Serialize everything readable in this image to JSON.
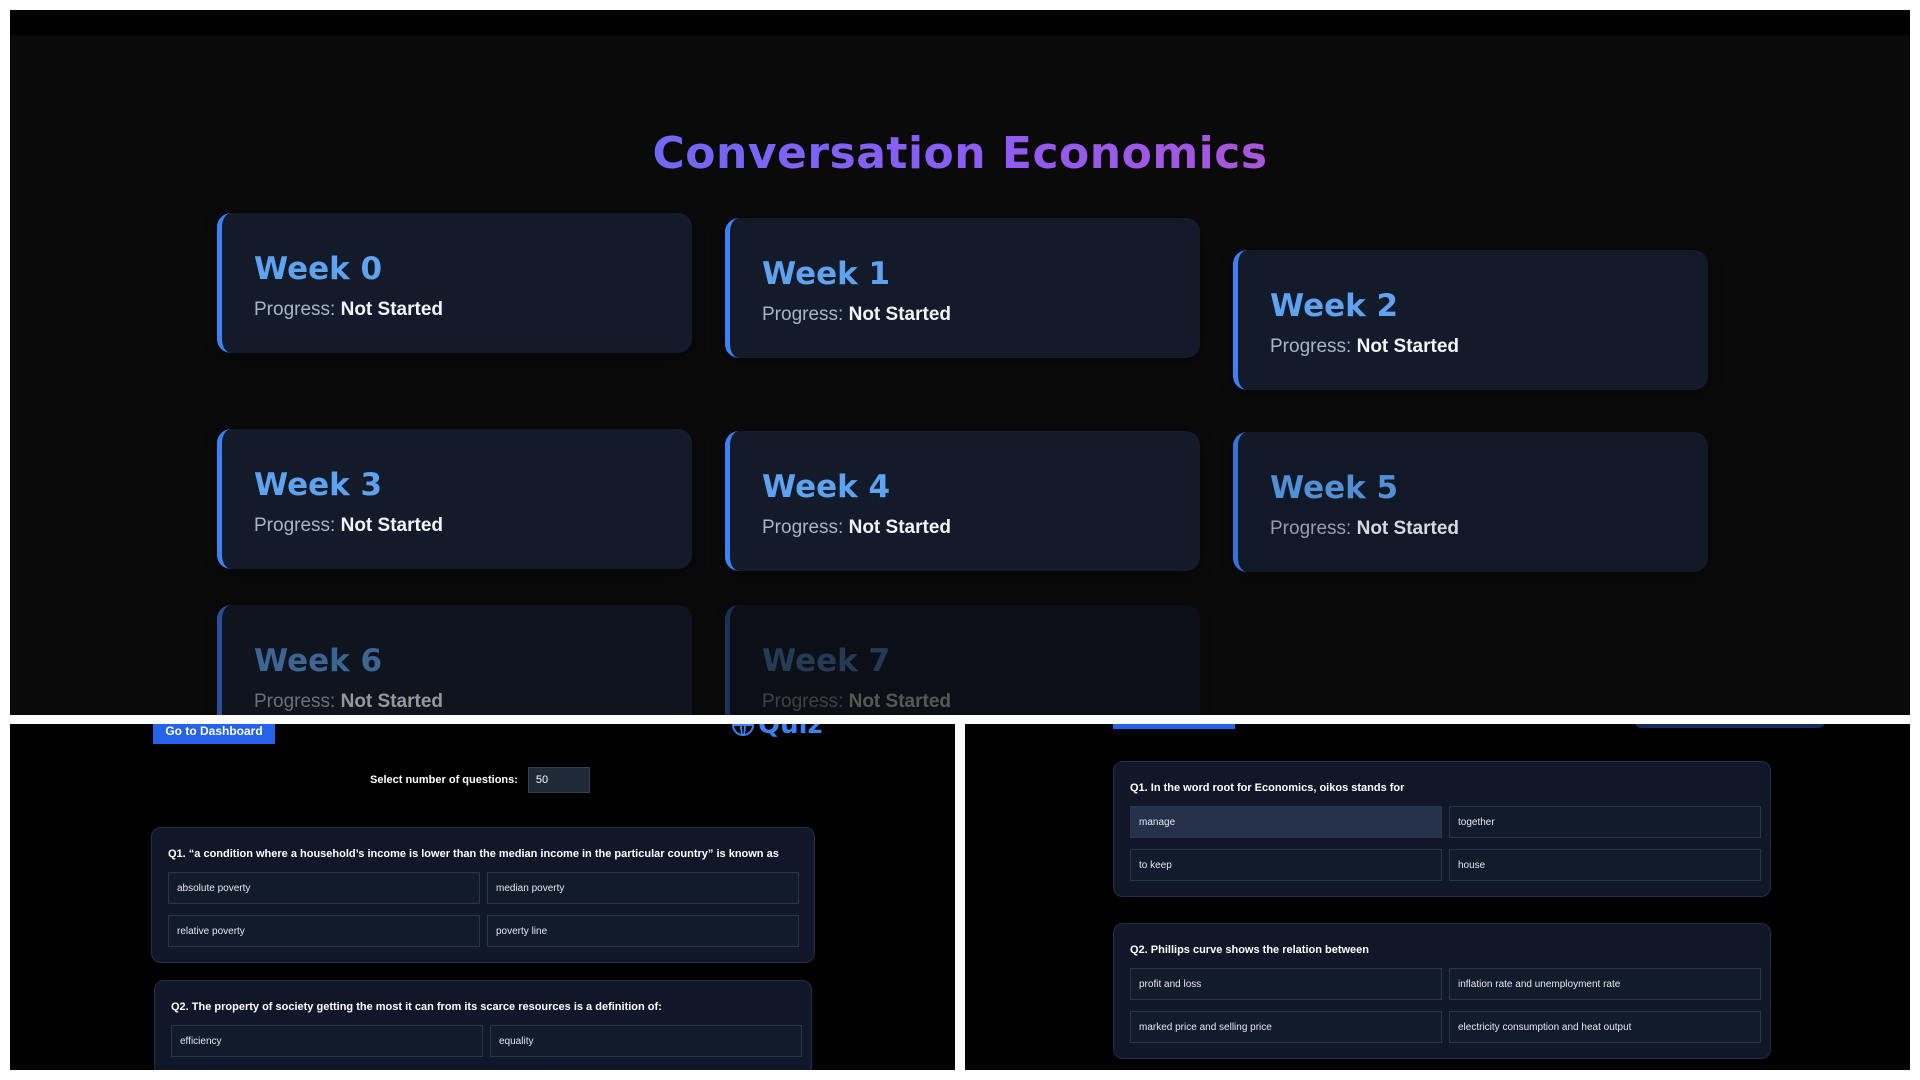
{
  "dashboard": {
    "title": "Conversation Economics",
    "progress_label": "Progress:",
    "weeks": [
      {
        "name": "Week 0",
        "status": "Not Started"
      },
      {
        "name": "Week 1",
        "status": "Not Started"
      },
      {
        "name": "Week 2",
        "status": "Not Started"
      },
      {
        "name": "Week 3",
        "status": "Not Started"
      },
      {
        "name": "Week 4",
        "status": "Not Started"
      },
      {
        "name": "Week 5",
        "status": "Not Started"
      },
      {
        "name": "Week 6",
        "status": "Not Started"
      },
      {
        "name": "Week 7",
        "status": "Not Started"
      }
    ]
  },
  "quiz": {
    "dashboard_button": "Go to Dashboard",
    "heading": "Quiz",
    "heading_icon": "globe-icon",
    "select_label": "Select number of questions:",
    "select_value": "50",
    "questions": [
      {
        "text": "Q1. “a condition where a household’s income is lower than the median income in the particular country” is known as",
        "options": [
          "absolute poverty",
          "median poverty",
          "relative poverty",
          "poverty line"
        ]
      },
      {
        "text": "Q2. The property of society getting the most it can from its scarce resources is a definition of:",
        "options": [
          "efficiency",
          "equality"
        ]
      }
    ]
  },
  "quiz_right": {
    "questions": [
      {
        "text": "Q1. In the word root for Economics, oikos stands for",
        "options": [
          "manage",
          "together",
          "to keep",
          "house"
        ]
      },
      {
        "text": "Q2. Phillips curve shows the relation between",
        "options": [
          "profit and loss",
          "inflation rate and unemployment rate",
          "marked price and selling price",
          "electricity consumption and heat output"
        ]
      }
    ]
  },
  "colors": {
    "accent": "#3b82f6",
    "title_gradient": [
      "#3b82f6",
      "#8b5cf6",
      "#ec4899"
    ],
    "card_bg": "#131b2b",
    "page_bg": "#0a0a0b"
  }
}
